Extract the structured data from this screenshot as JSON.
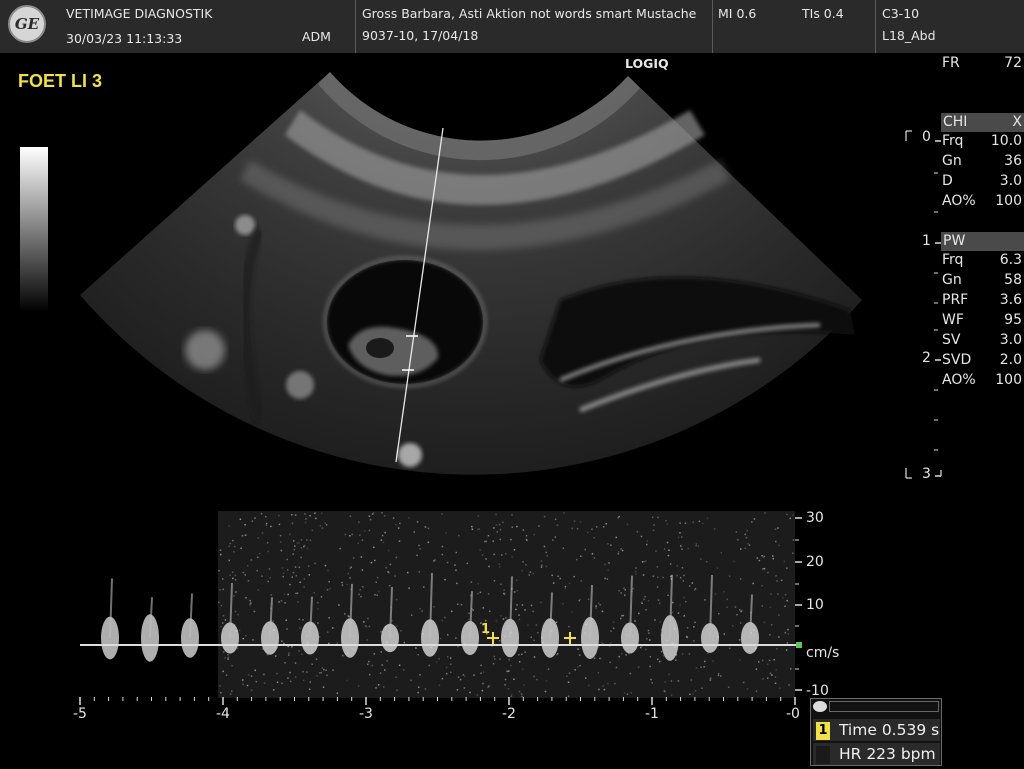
{
  "header": {
    "logo_text": "GE",
    "clinic": "VETIMAGE DIAGNOSTIK",
    "datetime": "30/03/23 11:13:33",
    "operator": "ADM",
    "patient": "Gross Barbara, Asti Aktion not words smart Mustache",
    "patient_id": "9037-10, 17/04/18",
    "mi": "MI 0.6",
    "tis": "TIs 0.4",
    "probe": "C3-10",
    "preset": "L18_Abd"
  },
  "image": {
    "annotation": "FOET LI 3",
    "brand": "LOGIQ"
  },
  "params": {
    "fr_label": "FR",
    "fr_value": "72",
    "chi_header": {
      "label": "CHI",
      "value": "X"
    },
    "chi": [
      {
        "label": "Frq",
        "value": "10.0"
      },
      {
        "label": "Gn",
        "value": "36"
      },
      {
        "label": "D",
        "value": "3.0"
      },
      {
        "label": "AO%",
        "value": "100"
      }
    ],
    "pw_header": {
      "label": "PW",
      "value": ""
    },
    "pw": [
      {
        "label": "Frq",
        "value": "6.3"
      },
      {
        "label": "Gn",
        "value": "58"
      },
      {
        "label": "PRF",
        "value": "3.6"
      },
      {
        "label": "WF",
        "value": "95"
      },
      {
        "label": "SV",
        "value": "3.0"
      },
      {
        "label": "SVD",
        "value": "2.0"
      },
      {
        "label": "AO%",
        "value": "100"
      }
    ]
  },
  "depth_scale": [
    "0",
    "1",
    "2",
    "3"
  ],
  "doppler": {
    "velocity_ticks": [
      "30",
      "20",
      "10",
      "-10"
    ],
    "velocity_unit": "cm/s",
    "time_ticks": [
      "-5",
      "-4",
      "-3",
      "-2",
      "-1",
      "-0"
    ],
    "caliper_label": "1"
  },
  "measurement": {
    "index": "1",
    "time_label": "Time",
    "time_value": "0.539 s",
    "hr_label": "HR",
    "hr_value": "223 bpm"
  }
}
